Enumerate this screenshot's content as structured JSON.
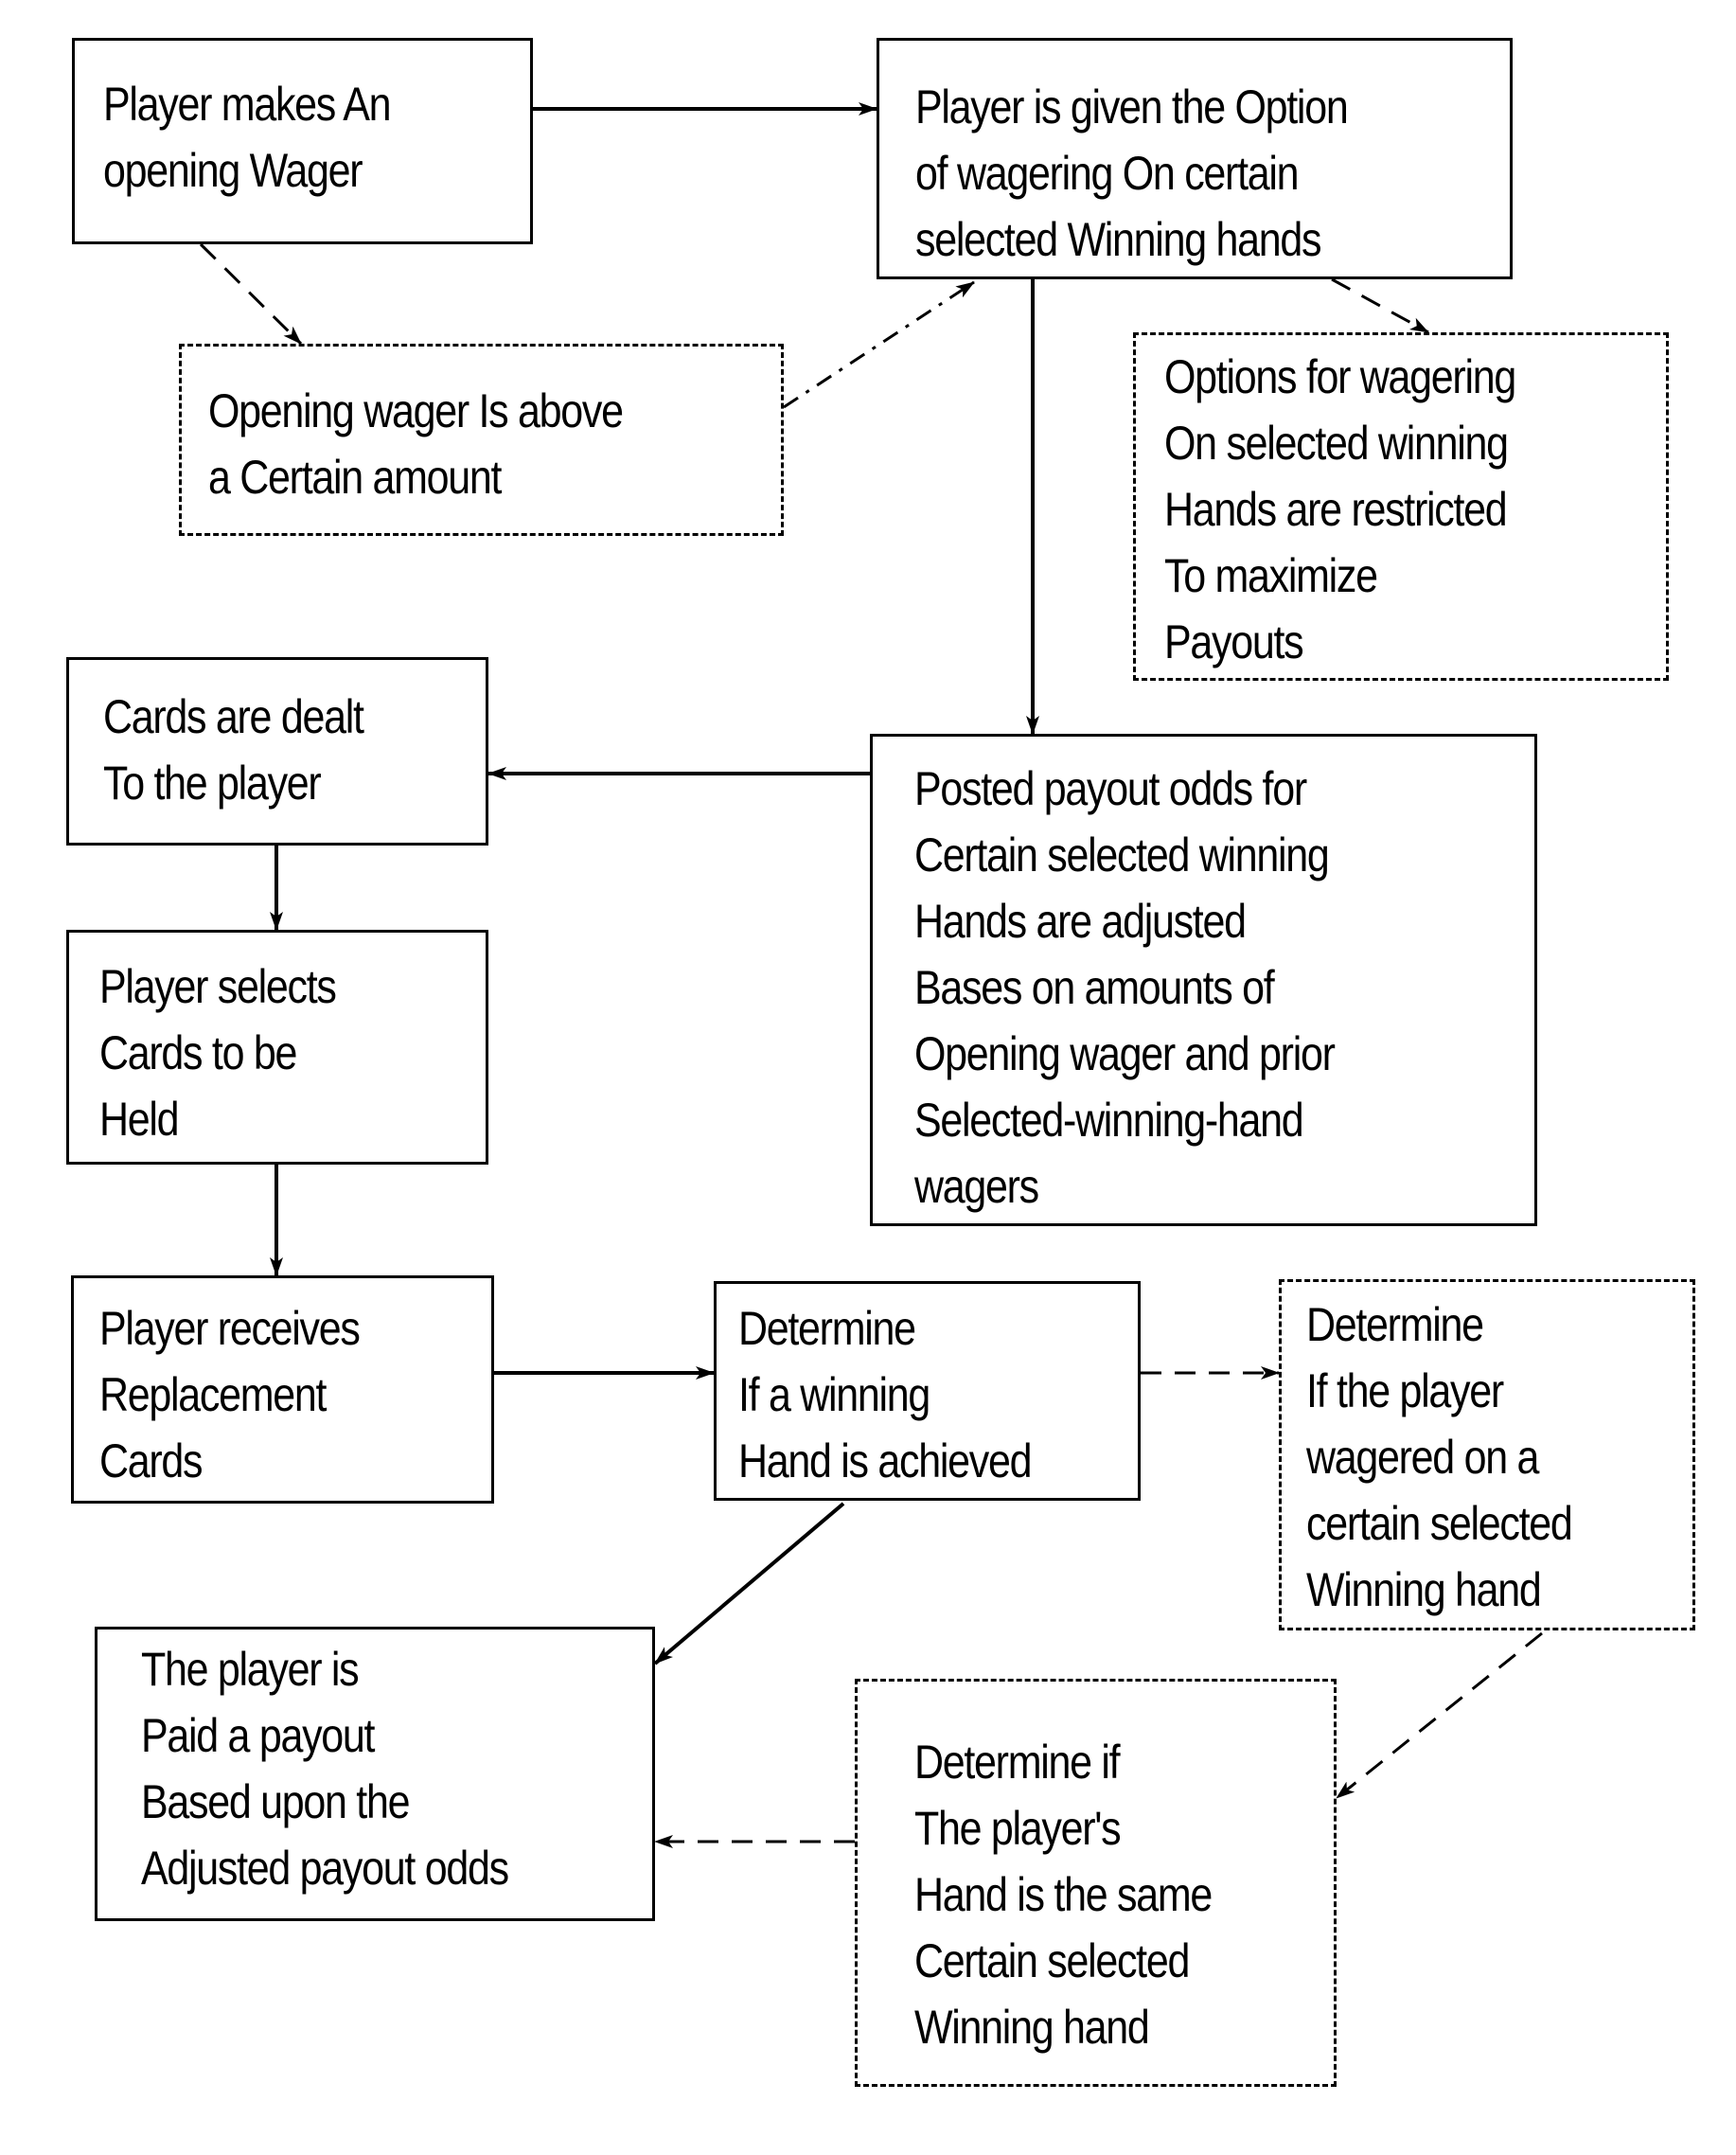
{
  "diagram": {
    "type": "flowchart",
    "nodes": [
      {
        "id": "opening-wager",
        "style": "solid",
        "lines": [
          "Player makes An",
          "opening Wager"
        ]
      },
      {
        "id": "wager-option",
        "style": "solid",
        "lines": [
          "Player is given the Option",
          "of wagering On certain",
          "selected Winning hands"
        ]
      },
      {
        "id": "above-amount",
        "style": "dashed",
        "lines": [
          "Opening wager Is above",
          "a Certain amount"
        ]
      },
      {
        "id": "options-restricted",
        "style": "dashed",
        "lines": [
          "Options for wagering",
          "On selected winning",
          "Hands are restricted",
          "To maximize",
          "Payouts"
        ]
      },
      {
        "id": "cards-dealt",
        "style": "solid",
        "lines": [
          "Cards are dealt",
          "To the player"
        ]
      },
      {
        "id": "posted-odds",
        "style": "solid",
        "lines": [
          "Posted payout  odds for",
          "Certain selected winning",
          "Hands are adjusted",
          "Bases on amounts of",
          "Opening wager and prior",
          "Selected-winning-hand",
          "wagers"
        ]
      },
      {
        "id": "select-held",
        "style": "solid",
        "lines": [
          "Player selects",
          "Cards to be",
          "Held"
        ]
      },
      {
        "id": "receives-replacement",
        "style": "solid",
        "lines": [
          "Player receives",
          "Replacement",
          "Cards"
        ]
      },
      {
        "id": "determine-winning",
        "style": "solid",
        "lines": [
          "Determine",
          "If a winning",
          "Hand is achieved"
        ]
      },
      {
        "id": "determine-wagered",
        "style": "dashed",
        "lines": [
          "Determine",
          "If the player",
          "wagered on a",
          "certain selected",
          "Winning hand"
        ]
      },
      {
        "id": "paid-payout",
        "style": "solid",
        "lines": [
          "The player is",
          "Paid a payout",
          "Based upon the",
          "Adjusted payout odds"
        ]
      },
      {
        "id": "determine-same",
        "style": "dashed",
        "lines": [
          "Determine if",
          "The player's",
          "Hand is the same",
          "Certain selected",
          "Winning hand"
        ]
      }
    ],
    "edges": [
      {
        "from": "opening-wager",
        "to": "wager-option",
        "style": "solid"
      },
      {
        "from": "opening-wager",
        "to": "above-amount",
        "style": "dashed"
      },
      {
        "from": "above-amount",
        "to": "wager-option",
        "style": "dashdot"
      },
      {
        "from": "wager-option",
        "to": "options-restricted",
        "style": "dashed"
      },
      {
        "from": "wager-option",
        "to": "posted-odds",
        "style": "solid"
      },
      {
        "from": "posted-odds",
        "to": "cards-dealt",
        "style": "solid"
      },
      {
        "from": "cards-dealt",
        "to": "select-held",
        "style": "solid"
      },
      {
        "from": "select-held",
        "to": "receives-replacement",
        "style": "solid"
      },
      {
        "from": "receives-replacement",
        "to": "determine-winning",
        "style": "solid"
      },
      {
        "from": "determine-winning",
        "to": "determine-wagered",
        "style": "dashed"
      },
      {
        "from": "determine-winning",
        "to": "paid-payout",
        "style": "solid"
      },
      {
        "from": "determine-wagered",
        "to": "determine-same",
        "style": "dashed"
      },
      {
        "from": "determine-same",
        "to": "paid-payout",
        "style": "dashed"
      }
    ]
  }
}
